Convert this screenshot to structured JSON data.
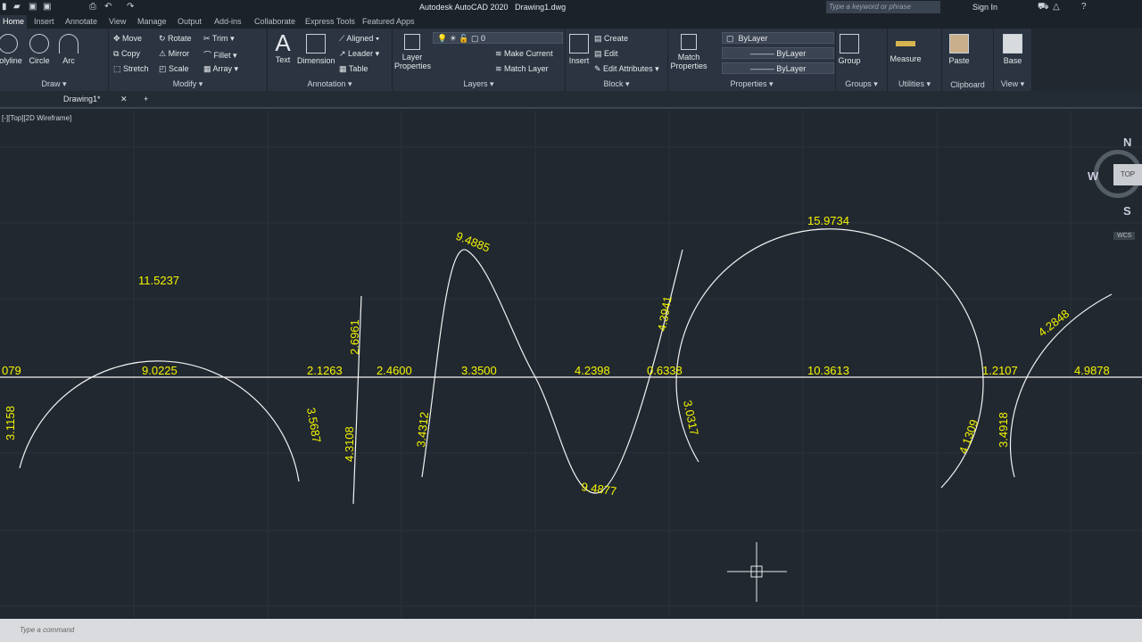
{
  "app": {
    "title": "Autodesk AutoCAD 2020",
    "file": "Drawing1.dwg",
    "search_placeholder": "Type a keyword or phrase",
    "sign_in": "Sign In"
  },
  "tabs": [
    "Home",
    "Insert",
    "Annotate",
    "View",
    "Manage",
    "Output",
    "Add-ins",
    "Collaborate",
    "Express Tools",
    "Featured Apps"
  ],
  "ribbon": {
    "draw": {
      "label": "Draw",
      "items": [
        "Polyline",
        "Circle",
        "Arc"
      ]
    },
    "modify": {
      "label": "Modify",
      "items": [
        "Move",
        "Rotate",
        "Trim",
        "Copy",
        "Mirror",
        "Fillet",
        "Stretch",
        "Scale",
        "Array"
      ]
    },
    "annotation": {
      "label": "Annotation",
      "items": [
        "Text",
        "Dimension",
        "Aligned",
        "Leader",
        "Table"
      ]
    },
    "layers": {
      "label": "Layers",
      "layer_properties": "Layer Properties",
      "current_layer": "0",
      "make_current": "Make Current",
      "match_layer": "Match Layer"
    },
    "block": {
      "label": "Block",
      "insert": "Insert",
      "create": "Create",
      "edit": "Edit",
      "edit_attributes": "Edit Attributes"
    },
    "properties": {
      "label": "Properties",
      "match": "Match Properties",
      "color": "ByLayer",
      "linetype": "ByLayer",
      "lineweight": "ByLayer"
    },
    "groups": {
      "label": "Groups",
      "group": "Group"
    },
    "utilities": {
      "label": "Utilities",
      "measure": "Measure"
    },
    "clipboard": {
      "label": "Clipboard",
      "paste": "Paste"
    },
    "view": {
      "label": "View",
      "base": "Base"
    }
  },
  "doc_tab": "Drawing1*",
  "viewport_label": "[-][Top][2D Wireframe]",
  "viewcube": {
    "n": "N",
    "w": "W",
    "s": "S",
    "top": "TOP",
    "wcs": "WCS"
  },
  "dimensions": {
    "d1": "11.5237",
    "d2": "9.0225",
    "d3": "2.1263",
    "d4": "2.6961",
    "d5": "2.4600",
    "d6": "9.4885",
    "d7": "3.3500",
    "d8": "4.2398",
    "d9": "0.6338",
    "d10": "4.3941",
    "d11": "15.9734",
    "d12": "10.3613",
    "d13": "1.2107",
    "d14": "4.2848",
    "d15": "4.9878",
    "d16": "3.1158",
    "d17": "3.5687",
    "d18": "4.3108",
    "d19": "3.4312",
    "d20": "9.4877",
    "d21": "3.0317",
    "d22": "4.1309",
    "d23": "3.4918",
    "d0": "079"
  },
  "command_placeholder": "Type a command",
  "colors": {
    "dimension_text": "#f5f500",
    "geometry": "#ffffff",
    "background": "#212830"
  }
}
